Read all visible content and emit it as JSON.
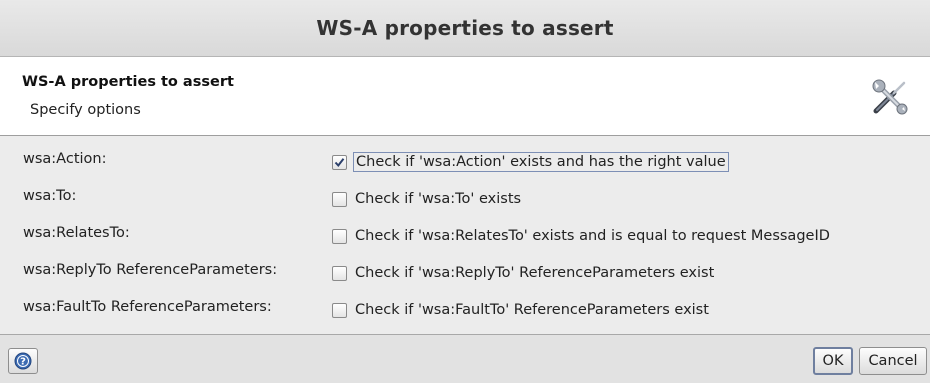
{
  "window": {
    "title": "WS-A properties to assert"
  },
  "header": {
    "title": "WS-A properties to assert",
    "subtitle": "Specify options",
    "icon": "tools-icon"
  },
  "rows": [
    {
      "label": "wsa:Action:",
      "checkbox_label": "Check if 'wsa:Action' exists and has the right value",
      "checked": true
    },
    {
      "label": "wsa:To:",
      "checkbox_label": "Check if 'wsa:To' exists",
      "checked": false
    },
    {
      "label": "wsa:RelatesTo:",
      "checkbox_label": "Check if 'wsa:RelatesTo' exists and is equal to request MessageID",
      "checked": false
    },
    {
      "label": "wsa:ReplyTo ReferenceParameters:",
      "checkbox_label": "Check if 'wsa:ReplyTo' ReferenceParameters exist",
      "checked": false
    },
    {
      "label": "wsa:FaultTo ReferenceParameters:",
      "checkbox_label": "Check if 'wsa:FaultTo' ReferenceParameters exist",
      "checked": false
    }
  ],
  "footer": {
    "help_icon": "help-icon",
    "ok_label": "OK",
    "cancel_label": "Cancel"
  }
}
